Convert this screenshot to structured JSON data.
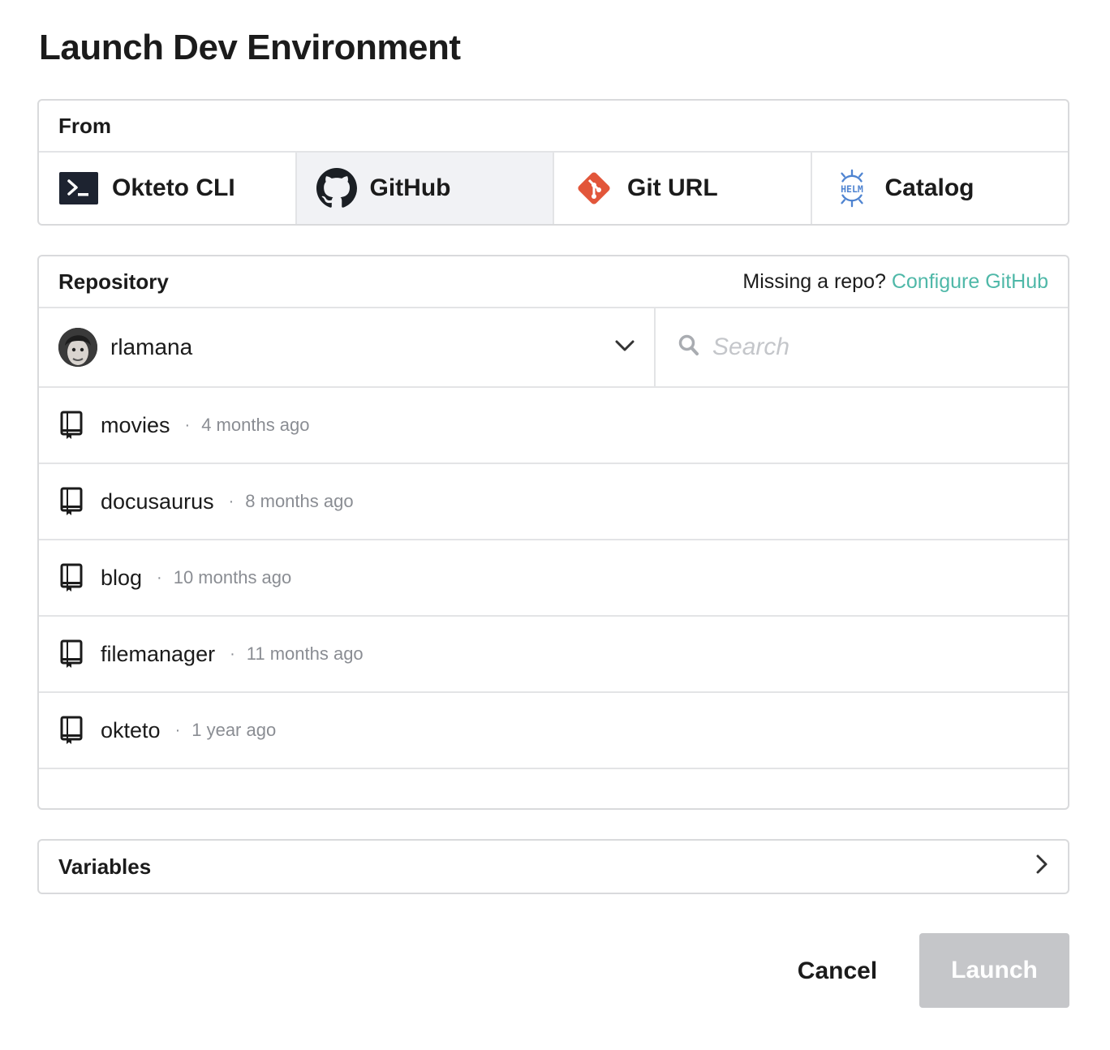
{
  "dialog": {
    "title": "Launch Dev Environment"
  },
  "from": {
    "label": "From",
    "sources": [
      {
        "label": "Okteto CLI",
        "icon": "terminal-icon"
      },
      {
        "label": "GitHub",
        "icon": "github-icon",
        "active": true
      },
      {
        "label": "Git URL",
        "icon": "git-icon"
      },
      {
        "label": "Catalog",
        "icon": "helm-icon"
      }
    ]
  },
  "repository": {
    "label": "Repository",
    "missing_text": "Missing a repo?",
    "configure_link": "Configure GitHub",
    "owner": "rlamana",
    "search_placeholder": "Search",
    "repos": [
      {
        "name": "movies",
        "updated": "4 months ago"
      },
      {
        "name": "docusaurus",
        "updated": "8 months ago"
      },
      {
        "name": "blog",
        "updated": "10 months ago"
      },
      {
        "name": "filemanager",
        "updated": "11 months ago"
      },
      {
        "name": "okteto",
        "updated": "1 year ago"
      }
    ]
  },
  "variables": {
    "label": "Variables"
  },
  "footer": {
    "cancel_label": "Cancel",
    "launch_label": "Launch"
  },
  "colors": {
    "accent_link": "#4fb8a8",
    "git_orange": "#e2563a",
    "helm_blue": "#4f84d1",
    "disabled_button": "#c5c6c9"
  }
}
